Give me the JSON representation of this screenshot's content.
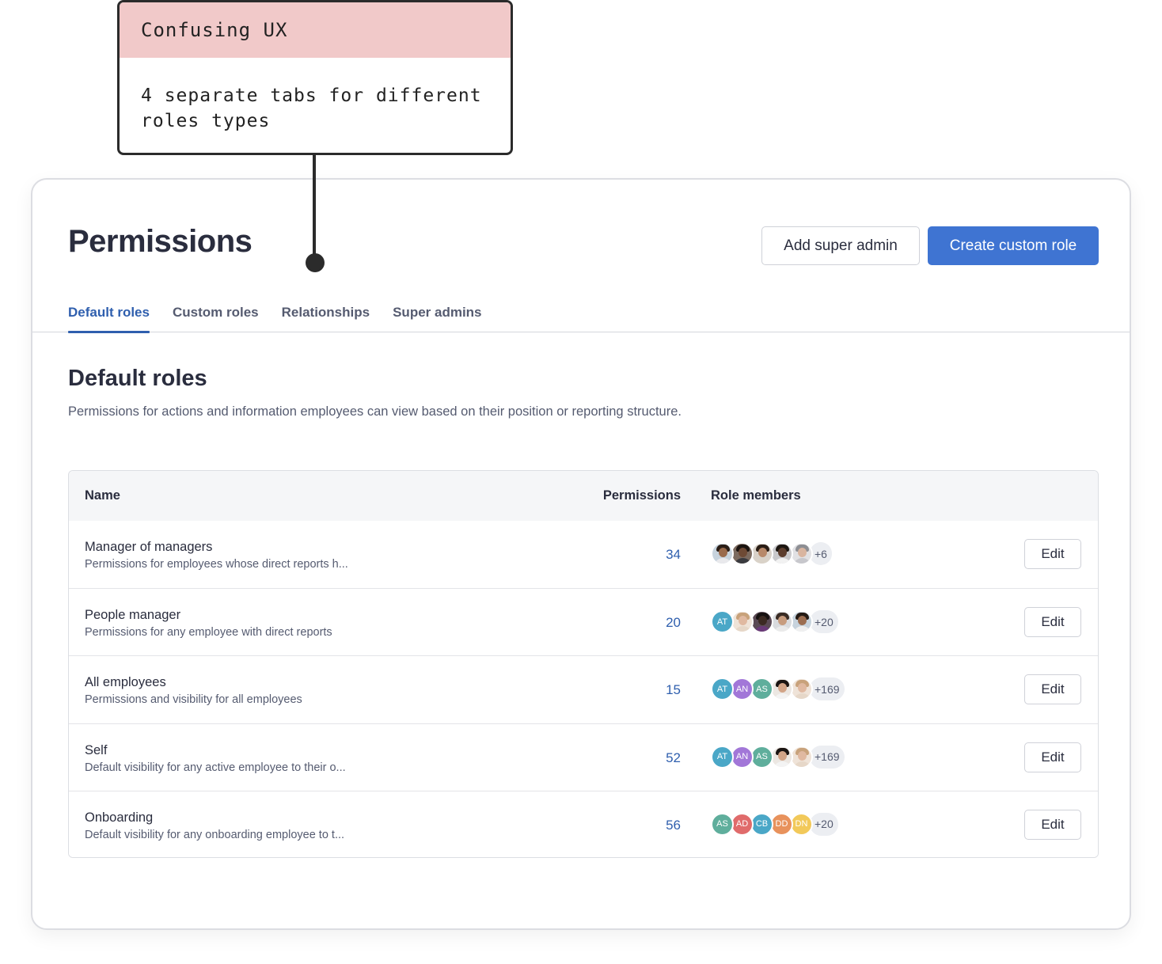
{
  "annotation": {
    "title": "Confusing UX",
    "body": "4 separate tabs for different roles types"
  },
  "header": {
    "title": "Permissions",
    "add_super_admin": "Add super admin",
    "create_custom_role": "Create custom role"
  },
  "tabs": [
    {
      "label": "Default roles",
      "active": true
    },
    {
      "label": "Custom roles",
      "active": false
    },
    {
      "label": "Relationships",
      "active": false
    },
    {
      "label": "Super admins",
      "active": false
    }
  ],
  "section": {
    "title": "Default roles",
    "description": "Permissions for actions and information employees can view based on their position or reporting structure."
  },
  "table": {
    "columns": {
      "name": "Name",
      "permissions": "Permissions",
      "members": "Role members"
    },
    "edit_label": "Edit",
    "rows": [
      {
        "name": "Manager of managers",
        "description": "Permissions for employees whose direct reports h...",
        "permissions": "34",
        "avatars": [
          {
            "type": "photo",
            "skin": "#9a6b4c",
            "hair": "#2b1e16",
            "shirt": "#e9e9ec",
            "bg": "#c7d3dd"
          },
          {
            "type": "photo",
            "skin": "#6e4a35",
            "hair": "#1b1410",
            "shirt": "#3a3a3f",
            "bg": "#7c6b60"
          },
          {
            "type": "photo",
            "skin": "#b8896a",
            "hair": "#2a1d15",
            "shirt": "#d9d2c8",
            "bg": "#d8d1c9"
          },
          {
            "type": "photo",
            "skin": "#5d3e2e",
            "hair": "#1d1712",
            "shirt": "#f2f2f2",
            "bg": "#c9c9cc"
          },
          {
            "type": "photo",
            "skin": "#d9b5a0",
            "hair": "#8d8e93",
            "shirt": "#c7c7cc",
            "bg": "#e1e1e4"
          }
        ],
        "more": "+6"
      },
      {
        "name": "People manager",
        "description": "Permissions for any employee with direct reports",
        "permissions": "20",
        "avatars": [
          {
            "type": "initials",
            "text": "AT",
            "color": "#4aa7c7"
          },
          {
            "type": "photo",
            "skin": "#e0b9a1",
            "hair": "#c8a27b",
            "shirt": "#e6d7c8",
            "bg": "#efe3d8"
          },
          {
            "type": "photo",
            "skin": "#3c2a22",
            "hair": "#171211",
            "shirt": "#6a3a78",
            "bg": "#5b4a55"
          },
          {
            "type": "photo",
            "skin": "#c79c7e",
            "hair": "#3a2c24",
            "shirt": "#eaeaea",
            "bg": "#d9dbde"
          },
          {
            "type": "photo",
            "skin": "#9c6e51",
            "hair": "#241a14",
            "shirt": "#f0f0f0",
            "bg": "#c7d3dd"
          }
        ],
        "more": "+20"
      },
      {
        "name": "All employees",
        "description": "Permissions and visibility for all employees",
        "permissions": "15",
        "avatars": [
          {
            "type": "initials",
            "text": "AT",
            "color": "#4aa7c7"
          },
          {
            "type": "initials",
            "text": "AN",
            "color": "#a277d8"
          },
          {
            "type": "initials",
            "text": "AS",
            "color": "#5fae9c"
          },
          {
            "type": "photo",
            "skin": "#d2a487",
            "hair": "#1a1412",
            "shirt": "#f3f3f3",
            "bg": "#ece7e2"
          },
          {
            "type": "photo",
            "skin": "#e0b9a1",
            "hair": "#c8a27b",
            "shirt": "#e6d7c8",
            "bg": "#efe3d8"
          }
        ],
        "more": "+169"
      },
      {
        "name": "Self",
        "description": "Default visibility for any active employee to their o...",
        "permissions": "52",
        "avatars": [
          {
            "type": "initials",
            "text": "AT",
            "color": "#4aa7c7"
          },
          {
            "type": "initials",
            "text": "AN",
            "color": "#a277d8"
          },
          {
            "type": "initials",
            "text": "AS",
            "color": "#5fae9c"
          },
          {
            "type": "photo",
            "skin": "#d2a487",
            "hair": "#1a1412",
            "shirt": "#f3f3f3",
            "bg": "#ece7e2"
          },
          {
            "type": "photo",
            "skin": "#e0b9a1",
            "hair": "#c8a27b",
            "shirt": "#e6d7c8",
            "bg": "#efe3d8"
          }
        ],
        "more": "+169"
      },
      {
        "name": "Onboarding",
        "description": "Default visibility for any onboarding employee to t...",
        "permissions": "56",
        "avatars": [
          {
            "type": "initials",
            "text": "AS",
            "color": "#5fae9c"
          },
          {
            "type": "initials",
            "text": "AD",
            "color": "#e06b6b"
          },
          {
            "type": "initials",
            "text": "CB",
            "color": "#4aa7c7"
          },
          {
            "type": "initials",
            "text": "DD",
            "color": "#e8925c"
          },
          {
            "type": "initials",
            "text": "DN",
            "color": "#f2c95a"
          }
        ],
        "more": "+20"
      }
    ]
  }
}
